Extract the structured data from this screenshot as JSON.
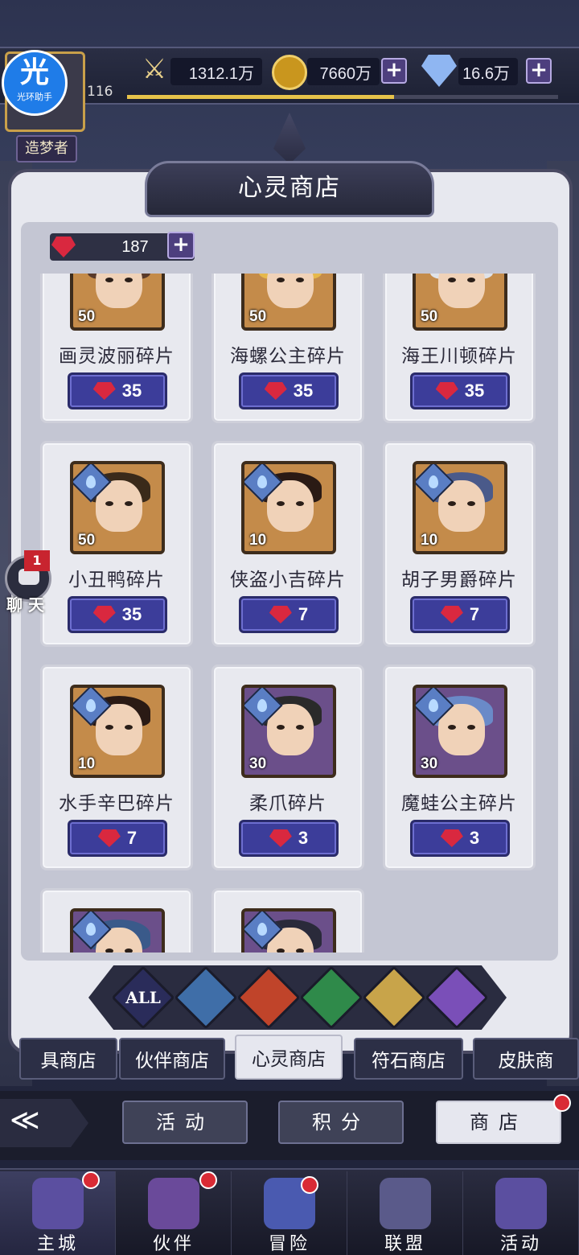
{
  "helper": {
    "big": "光",
    "small": "光环助手"
  },
  "player": {
    "level": "116",
    "title": "造梦者",
    "xp_fraction": 0.62
  },
  "resources": {
    "power": "1312.1万",
    "gold": "7660万",
    "diamond": "16.6万"
  },
  "shop": {
    "title": "心灵商店",
    "currency_value": "187"
  },
  "items": [
    {
      "name": "画灵波丽碎片",
      "level": "50",
      "price": "35",
      "frame": "gold"
    },
    {
      "name": "海螺公主碎片",
      "level": "50",
      "price": "35",
      "frame": "gold"
    },
    {
      "name": "海王川顿碎片",
      "level": "50",
      "price": "35",
      "frame": "gold"
    },
    {
      "name": "小丑鸭碎片",
      "level": "50",
      "price": "35",
      "frame": "gold"
    },
    {
      "name": "侠盗小吉碎片",
      "level": "10",
      "price": "7",
      "frame": "gold"
    },
    {
      "name": "胡子男爵碎片",
      "level": "10",
      "price": "7",
      "frame": "gold"
    },
    {
      "name": "水手辛巴碎片",
      "level": "10",
      "price": "7",
      "frame": "gold"
    },
    {
      "name": "柔爪碎片",
      "level": "30",
      "price": "3",
      "frame": "purple"
    },
    {
      "name": "魔蛙公主碎片",
      "level": "30",
      "price": "3",
      "frame": "purple"
    },
    {
      "name": "",
      "level": "",
      "price": "",
      "frame": "purple"
    },
    {
      "name": "",
      "level": "",
      "price": "",
      "frame": "purple"
    }
  ],
  "chat": {
    "badge": "1",
    "label": "聊 天"
  },
  "filters": [
    {
      "label": "ALL",
      "color": "#2a2c5a"
    },
    {
      "label": "",
      "color": "#3f6ea8"
    },
    {
      "label": "",
      "color": "#c0442a"
    },
    {
      "label": "",
      "color": "#2f8a4a"
    },
    {
      "label": "",
      "color": "#c8a44a"
    },
    {
      "label": "",
      "color": "#7a4fb8"
    }
  ],
  "tabs": [
    "具商店",
    "伙伴商店",
    "心灵商店",
    "符石商店",
    "皮肤商"
  ],
  "modes": {
    "activity": "活动",
    "points": "积分",
    "shop": "商店"
  },
  "nav": [
    "主城",
    "伙伴",
    "冒险",
    "联盟",
    "活动"
  ],
  "colors": {
    "accent_gold": "#e7c34a",
    "price_blue": "#3c3d9a",
    "badge_red": "#d92b35"
  }
}
